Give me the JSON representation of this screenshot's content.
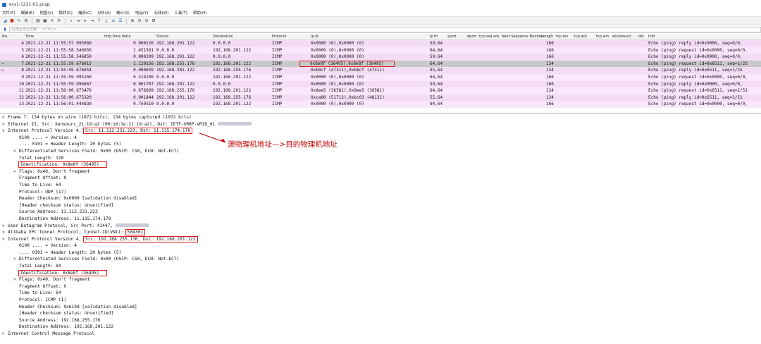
{
  "window": {
    "title": "ecs1-1221-02.pcap"
  },
  "menu": [
    "文件(F)",
    "编辑(E)",
    "视图(V)",
    "跳转(G)",
    "捕获(C)",
    "分析(A)",
    "统计(S)",
    "电话(Y)",
    "无线(W)",
    "工具(T)",
    "帮助(H)"
  ],
  "filter": {
    "placeholder": "应用显示过滤器 … <Ctrl-/>"
  },
  "columns": [
    "No.",
    "Time",
    "http.time.delta",
    "Source",
    "Destination",
    "Protocol",
    "ip.id",
    "ip.ttl",
    "sport",
    "dport",
    "tcp.seq",
    "ack",
    "Next Sequence Number",
    "Length",
    "tcp.len",
    "tcp.ack",
    "tcp.win",
    "window",
    "src",
    "dst",
    "Info"
  ],
  "packets": [
    {
      "no": "4",
      "time": "2021-12-21 11:55:57.095089",
      "delta": "0.000226",
      "source": "192.168.201.122",
      "destination": "0.0.0.0",
      "protocol": "ICMP",
      "ipid": "0x0000 (0),0x0000 (0)",
      "ttl": "59,64",
      "length": "166",
      "info": "Echo (ping) reply    id=0x0000, seq=0/0,",
      "cls": "icmp",
      "mark": ""
    },
    {
      "no": "5",
      "time": "2021-12-21 11:55:58.546650",
      "delta": "1.451561",
      "source": "0.0.0.0",
      "destination": "192.168.201.122",
      "protocol": "ICMP",
      "ipid": "0x0000 (0),0x0000 (0)",
      "ttl": "64,64",
      "length": "166",
      "info": "Echo (ping) request  id=0x0000, seq=0/0,",
      "cls": "alt",
      "mark": ""
    },
    {
      "no": "6",
      "time": "2021-12-21 11:55:58.546859",
      "delta": "0.000209",
      "source": "192.168.201.122",
      "destination": "0.0.0.0",
      "protocol": "ICMP",
      "ipid": "0x0000 (0),0x0000 (0)",
      "ttl": "59,64",
      "length": "166",
      "info": "Echo (ping) reply    id=0x0000, seq=0/0,",
      "cls": "icmp",
      "mark": ""
    },
    {
      "no": "7",
      "time": "2021-12-21 11:55:59.676015",
      "delta": "1.129156",
      "source": "192.168.255.176",
      "destination": "192.168.201.122",
      "protocol": "ICMP",
      "ipid": "0x8e8f (36495),0x8e8f (36495)",
      "ttl": "64,64",
      "length": "134",
      "info": "Echo (ping) request  id=0x6511, seq=1/25",
      "cls": "sel",
      "mark": "→"
    },
    {
      "no": "8",
      "time": "2021-12-21 11:55:59.676054",
      "delta": "0.000039",
      "source": "192.168.201.122",
      "destination": "192.168.255.176",
      "protocol": "ICMP",
      "ipid": "0xb8cf (47311),0xb8cf (47311)",
      "ttl": "55,64",
      "length": "134",
      "info": "Echo (ping) reply    id=0x6511, seq=1/25",
      "cls": "icmp",
      "mark": "←"
    },
    {
      "no": "9",
      "time": "2021-12-21 11:55:59.995160",
      "delta": "0.319106",
      "source": "0.0.0.0",
      "destination": "192.168.201.122",
      "protocol": "ICMP",
      "ipid": "0x0000 (0),0x0000 (0)",
      "ttl": "64,64",
      "length": "166",
      "info": "Echo (ping) request  id=0x0000, seq=0/0,",
      "cls": "alt",
      "mark": ""
    },
    {
      "no": "10",
      "time": "2021-12-21 11:55:59.996867",
      "delta": "0.001707",
      "source": "192.168.201.122",
      "destination": "0.0.0.0",
      "protocol": "ICMP",
      "ipid": "0x0000 (0),0x0000 (0)",
      "ttl": "59,64",
      "length": "166",
      "info": "Echo (ping) reply    id=0x0000, seq=0/0,",
      "cls": "icmp",
      "mark": ""
    },
    {
      "no": "11",
      "time": "2021-12-21 11:56:00.673476",
      "delta": "0.676609",
      "source": "192.168.255.176",
      "destination": "192.168.201.122",
      "protocol": "ICMP",
      "ipid": "0x8ee5 (36581),0x8ee5 (36581)",
      "ttl": "64,64",
      "length": "134",
      "info": "Echo (ping) request  id=0x6511, seq=2/51",
      "cls": "alt",
      "mark": ""
    },
    {
      "no": "12",
      "time": "2021-12-21 11:56:00.675320",
      "delta": "0.001844",
      "source": "192.168.201.122",
      "destination": "192.168.255.176",
      "protocol": "ICMP",
      "ipid": "0xca00 (51712),0xbc03 (48131)",
      "ttl": "55,64",
      "length": "134",
      "info": "Echo (ping) reply    id=0x6511, seq=2/51",
      "cls": "icmp",
      "mark": ""
    },
    {
      "no": "13",
      "time": "2021-12-21 11:56:01.444830",
      "delta": "0.769510",
      "source": "0.0.0.0",
      "destination": "192.168.201.122",
      "protocol": "ICMP",
      "ipid": "0x0000 (0),0x0000 (0)",
      "ttl": "64,64",
      "length": "166",
      "info": "Echo (ping) request  id=0x0000, seq=0/0,",
      "cls": "alt",
      "mark": ""
    }
  ],
  "details": [
    {
      "text": "Frame 7: 134 bytes on wire (1072 bits), 134 bytes captured (1072 bits)",
      "level": "l0",
      "arrow": ">",
      "hl": "",
      "blur": false
    },
    {
      "text": "Ethernet II, Src: Xensourc_21:19:a2 (00:16:3e:21:19:a2), Dst: IETF-VRRP-VRID_01",
      "level": "l0",
      "arrow": ">",
      "hl": "",
      "blur": true
    },
    {
      "text": "Internet Protocol Version 4, Src: 11.112.231.223, Dst: 11.115.174.178",
      "level": "l0",
      "arrow": "v",
      "hl": "src",
      "blur": false
    },
    {
      "text": "0100 .... = Version: 4",
      "level": "l1",
      "arrow": "",
      "hl": "",
      "blur": false
    },
    {
      "text": ".... 0101 = Header Length: 20 bytes (5)",
      "level": "l1",
      "arrow": "",
      "hl": "",
      "blur": false
    },
    {
      "text": "Differentiated Services Field: 0x00 (DSCP: CS0, ECN: Not-ECT)",
      "level": "l1",
      "arrow": ">",
      "hl": "",
      "blur": false
    },
    {
      "text": "Total Length: 120",
      "level": "l1",
      "arrow": "",
      "hl": "",
      "blur": false
    },
    {
      "text": "Identification: 0x8e8f (36495)",
      "level": "l1",
      "arrow": "",
      "hl": "full",
      "blur": false
    },
    {
      "text": "Flags: 0x40, Don't fragment",
      "level": "l1",
      "arrow": ">",
      "hl": "",
      "blur": false
    },
    {
      "text": "Fragment Offset: 0",
      "level": "l1",
      "arrow": "",
      "hl": "",
      "blur": false
    },
    {
      "text": "Time to Live: 64",
      "level": "l1",
      "arrow": "",
      "hl": "",
      "blur": false
    },
    {
      "text": "Protocol: UDP (17)",
      "level": "l1",
      "arrow": "",
      "hl": "",
      "blur": false
    },
    {
      "text": "Header Checksum: 0x0000 [validation disabled]",
      "level": "l1",
      "arrow": "",
      "hl": "",
      "blur": false
    },
    {
      "text": "[Header checksum status: Unverified]",
      "level": "l1",
      "arrow": "",
      "hl": "",
      "blur": false
    },
    {
      "text": "Source Address: 11.112.231.223",
      "level": "l1",
      "arrow": "",
      "hl": "",
      "blur": false
    },
    {
      "text": "Destination Address: 11.115.174.178",
      "level": "l1",
      "arrow": "",
      "hl": "",
      "blur": false
    },
    {
      "text": "User Datagram Protocol, Src Port: 41447,",
      "level": "l0",
      "arrow": ">",
      "hl": "",
      "blur": true
    },
    {
      "text": "Alibaba VPC Tunnel Protocol, Tunnel-ID(VNI): 504301",
      "level": "l0",
      "arrow": ">",
      "hl": "vni",
      "blur": false
    },
    {
      "text": "Internet Protocol Version 4, Src: 192.168.255.176, Dst: 192.168.201.122",
      "level": "l0",
      "arrow": "v",
      "hl": "src",
      "blur": false
    },
    {
      "text": "0100 .... = Version: 4",
      "level": "l1",
      "arrow": "",
      "hl": "",
      "blur": false
    },
    {
      "text": ".... 0101 = Header Length: 20 bytes (5)",
      "level": "l1",
      "arrow": "",
      "hl": "",
      "blur": false
    },
    {
      "text": "Differentiated Services Field: 0x00 (DSCP: CS0, ECN: Not-ECT)",
      "level": "l1",
      "arrow": ">",
      "hl": "",
      "blur": false
    },
    {
      "text": "Total Length: 84",
      "level": "l1",
      "arrow": "",
      "hl": "",
      "blur": false
    },
    {
      "text": "Identification: 0x8e8f (36495)",
      "level": "l1",
      "arrow": "",
      "hl": "full",
      "blur": false
    },
    {
      "text": "Flags: 0x40, Don't fragment",
      "level": "l1",
      "arrow": ">",
      "hl": "",
      "blur": false
    },
    {
      "text": "Fragment Offset: 0",
      "level": "l1",
      "arrow": "",
      "hl": "",
      "blur": false
    },
    {
      "text": "Time to Live: 64",
      "level": "l1",
      "arrow": "",
      "hl": "",
      "blur": false
    },
    {
      "text": "Protocol: ICMP (1)",
      "level": "l1",
      "arrow": "",
      "hl": "",
      "blur": false
    },
    {
      "text": "Header Checksum: 0x619d [validation disabled]",
      "level": "l1",
      "arrow": "",
      "hl": "",
      "blur": false
    },
    {
      "text": "[Header checksum status: Unverified]",
      "level": "l1",
      "arrow": "",
      "hl": "",
      "blur": false
    },
    {
      "text": "Source Address: 192.168.255.176",
      "level": "l1",
      "arrow": "",
      "hl": "",
      "blur": false
    },
    {
      "text": "Destination Address: 192.168.201.122",
      "level": "l1",
      "arrow": "",
      "hl": "",
      "blur": false
    },
    {
      "text": "Internet Control Message Protocol",
      "level": "l0",
      "arrow": ">",
      "hl": "",
      "blur": false
    }
  ],
  "annotation": {
    "text": "源物理机地址—>目的物理机地址"
  },
  "colors": {
    "icmp_row": "#f4dcf6",
    "selected_row": "#c9c9c9",
    "highlight": "#e02020",
    "annotation": "#c00000"
  }
}
